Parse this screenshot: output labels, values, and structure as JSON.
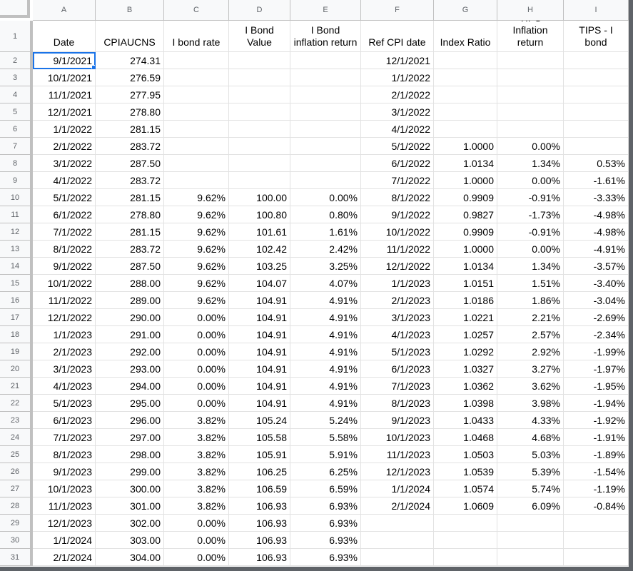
{
  "columns": [
    "A",
    "B",
    "C",
    "D",
    "E",
    "F",
    "G",
    "H",
    "I"
  ],
  "headers": [
    "Date",
    "CPIAUCNS",
    "I bond rate",
    "I Bond Value",
    "I Bond inflation return",
    "Ref CPI date",
    "Index Ratio",
    "TIPS Inflation return",
    "TIPS - I bond"
  ],
  "rows": [
    [
      "9/1/2021",
      "274.31",
      "",
      "",
      "",
      "12/1/2021",
      "",
      "",
      ""
    ],
    [
      "10/1/2021",
      "276.59",
      "",
      "",
      "",
      "1/1/2022",
      "",
      "",
      ""
    ],
    [
      "11/1/2021",
      "277.95",
      "",
      "",
      "",
      "2/1/2022",
      "",
      "",
      ""
    ],
    [
      "12/1/2021",
      "278.80",
      "",
      "",
      "",
      "3/1/2022",
      "",
      "",
      ""
    ],
    [
      "1/1/2022",
      "281.15",
      "",
      "",
      "",
      "4/1/2022",
      "",
      "",
      ""
    ],
    [
      "2/1/2022",
      "283.72",
      "",
      "",
      "",
      "5/1/2022",
      "1.0000",
      "0.00%",
      ""
    ],
    [
      "3/1/2022",
      "287.50",
      "",
      "",
      "",
      "6/1/2022",
      "1.0134",
      "1.34%",
      "0.53%"
    ],
    [
      "4/1/2022",
      "283.72",
      "",
      "",
      "",
      "7/1/2022",
      "1.0000",
      "0.00%",
      "-1.61%"
    ],
    [
      "5/1/2022",
      "281.15",
      "9.62%",
      "100.00",
      "0.00%",
      "8/1/2022",
      "0.9909",
      "-0.91%",
      "-3.33%"
    ],
    [
      "6/1/2022",
      "278.80",
      "9.62%",
      "100.80",
      "0.80%",
      "9/1/2022",
      "0.9827",
      "-1.73%",
      "-4.98%"
    ],
    [
      "7/1/2022",
      "281.15",
      "9.62%",
      "101.61",
      "1.61%",
      "10/1/2022",
      "0.9909",
      "-0.91%",
      "-4.98%"
    ],
    [
      "8/1/2022",
      "283.72",
      "9.62%",
      "102.42",
      "2.42%",
      "11/1/2022",
      "1.0000",
      "0.00%",
      "-4.91%"
    ],
    [
      "9/1/2022",
      "287.50",
      "9.62%",
      "103.25",
      "3.25%",
      "12/1/2022",
      "1.0134",
      "1.34%",
      "-3.57%"
    ],
    [
      "10/1/2022",
      "288.00",
      "9.62%",
      "104.07",
      "4.07%",
      "1/1/2023",
      "1.0151",
      "1.51%",
      "-3.40%"
    ],
    [
      "11/1/2022",
      "289.00",
      "9.62%",
      "104.91",
      "4.91%",
      "2/1/2023",
      "1.0186",
      "1.86%",
      "-3.04%"
    ],
    [
      "12/1/2022",
      "290.00",
      "0.00%",
      "104.91",
      "4.91%",
      "3/1/2023",
      "1.0221",
      "2.21%",
      "-2.69%"
    ],
    [
      "1/1/2023",
      "291.00",
      "0.00%",
      "104.91",
      "4.91%",
      "4/1/2023",
      "1.0257",
      "2.57%",
      "-2.34%"
    ],
    [
      "2/1/2023",
      "292.00",
      "0.00%",
      "104.91",
      "4.91%",
      "5/1/2023",
      "1.0292",
      "2.92%",
      "-1.99%"
    ],
    [
      "3/1/2023",
      "293.00",
      "0.00%",
      "104.91",
      "4.91%",
      "6/1/2023",
      "1.0327",
      "3.27%",
      "-1.97%"
    ],
    [
      "4/1/2023",
      "294.00",
      "0.00%",
      "104.91",
      "4.91%",
      "7/1/2023",
      "1.0362",
      "3.62%",
      "-1.95%"
    ],
    [
      "5/1/2023",
      "295.00",
      "0.00%",
      "104.91",
      "4.91%",
      "8/1/2023",
      "1.0398",
      "3.98%",
      "-1.94%"
    ],
    [
      "6/1/2023",
      "296.00",
      "3.82%",
      "105.24",
      "5.24%",
      "9/1/2023",
      "1.0433",
      "4.33%",
      "-1.92%"
    ],
    [
      "7/1/2023",
      "297.00",
      "3.82%",
      "105.58",
      "5.58%",
      "10/1/2023",
      "1.0468",
      "4.68%",
      "-1.91%"
    ],
    [
      "8/1/2023",
      "298.00",
      "3.82%",
      "105.91",
      "5.91%",
      "11/1/2023",
      "1.0503",
      "5.03%",
      "-1.89%"
    ],
    [
      "9/1/2023",
      "299.00",
      "3.82%",
      "106.25",
      "6.25%",
      "12/1/2023",
      "1.0539",
      "5.39%",
      "-1.54%"
    ],
    [
      "10/1/2023",
      "300.00",
      "3.82%",
      "106.59",
      "6.59%",
      "1/1/2024",
      "1.0574",
      "5.74%",
      "-1.19%"
    ],
    [
      "11/1/2023",
      "301.00",
      "3.82%",
      "106.93",
      "6.93%",
      "2/1/2024",
      "1.0609",
      "6.09%",
      "-0.84%"
    ],
    [
      "12/1/2023",
      "302.00",
      "0.00%",
      "106.93",
      "6.93%",
      "",
      "",
      "",
      ""
    ],
    [
      "1/1/2024",
      "303.00",
      "0.00%",
      "106.93",
      "6.93%",
      "",
      "",
      "",
      ""
    ],
    [
      "2/1/2024",
      "304.00",
      "0.00%",
      "106.93",
      "6.93%",
      "",
      "",
      "",
      ""
    ]
  ],
  "selected_cell": "A2"
}
